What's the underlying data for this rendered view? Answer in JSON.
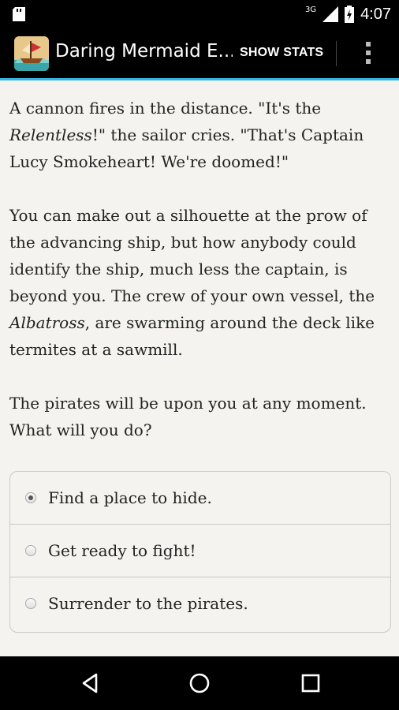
{
  "status_bar": {
    "network": "3G",
    "time": "4:07"
  },
  "action_bar": {
    "title": "Daring Mermaid E...",
    "show_stats": "SHOW STATS"
  },
  "story": {
    "p1_a": "A cannon fires in the distance. \"It's the ",
    "p1_em": "Relentless",
    "p1_b": "!\" the sailor cries. \"That's Captain Lucy Smokeheart! We're doomed!\"",
    "p2_a": "You can make out a silhouette at the prow of the advancing ship, but how anybody could identify the ship, much less the captain, is beyond you. The crew of your own vessel, the ",
    "p2_em": "Albatross",
    "p2_b": ", are swarming around the deck like termites at a sawmill.",
    "p3": "The pirates will be upon you at any moment. What will you do?"
  },
  "choices": [
    {
      "label": "Find a place to hide.",
      "selected": true
    },
    {
      "label": "Get ready to fight!",
      "selected": false
    },
    {
      "label": "Surrender to the pirates.",
      "selected": false
    }
  ],
  "colors": {
    "accent": "#33b5e5",
    "background": "#f4f3ef",
    "bars": "#000000"
  }
}
